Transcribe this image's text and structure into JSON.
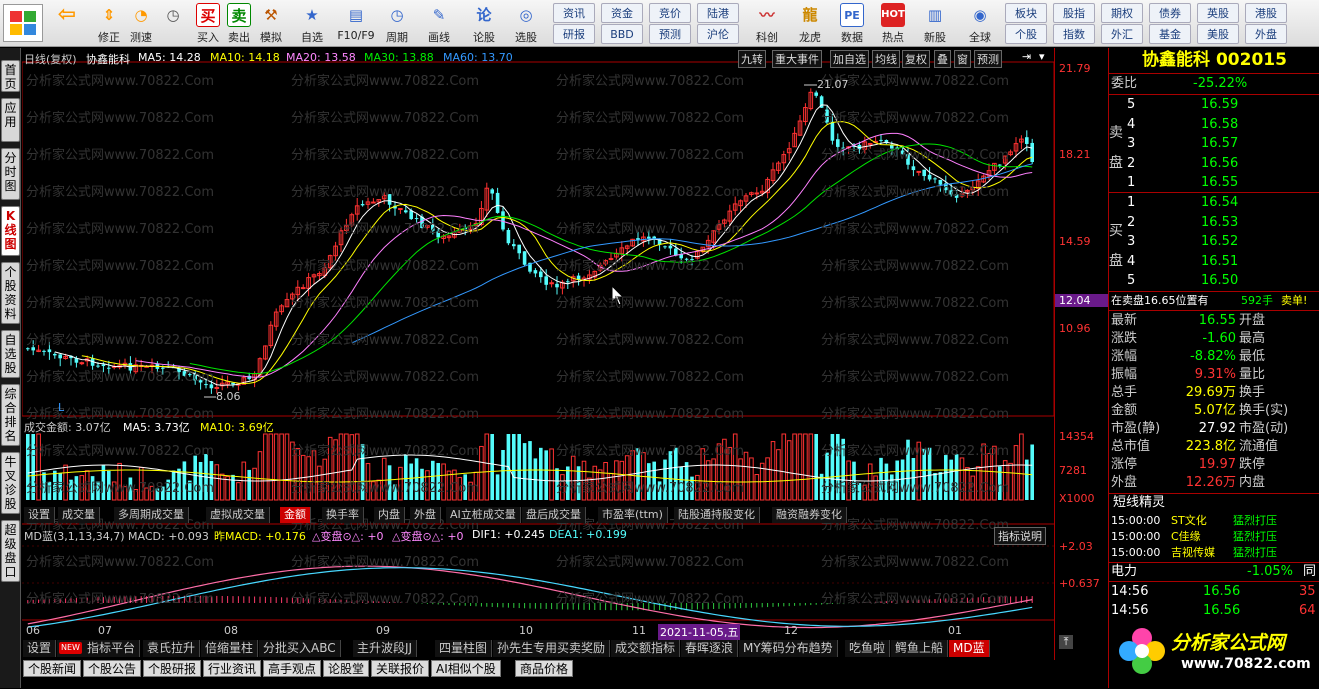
{
  "toolbar": {
    "buttons": [
      {
        "label": "",
        "icon": "logo-icon"
      },
      {
        "label": "",
        "icon": "back-arrow-icon"
      },
      {
        "label": "修正",
        "icon": "up-down-icon"
      },
      {
        "label": "测速",
        "icon": "stopwatch-icon"
      },
      {
        "label": "",
        "icon": "clock-icon"
      },
      {
        "label": "买入",
        "icon": "buy-icon"
      },
      {
        "label": "卖出",
        "icon": "sell-icon"
      },
      {
        "label": "模拟",
        "icon": "hammer-icon"
      },
      {
        "label": "自选",
        "icon": "star-icon"
      },
      {
        "label": "F10/F9",
        "icon": "f10-icon"
      },
      {
        "label": "周期",
        "icon": "period-icon"
      },
      {
        "label": "画线",
        "icon": "pencil-icon"
      },
      {
        "label": "论股",
        "icon": "forum-icon"
      },
      {
        "label": "选股",
        "icon": "select-icon"
      }
    ],
    "grid1": [
      "资讯",
      "资金",
      "竞价",
      "陆港",
      "研报",
      "BBD",
      "预测",
      "沪伦"
    ],
    "grid1_right": [
      {
        "label": "科创",
        "icon": "chart-icon"
      },
      {
        "label": "龙虎",
        "icon": "dragon-icon"
      },
      {
        "label": "数据",
        "icon": "pe-icon"
      },
      {
        "label": "热点",
        "icon": "hot-icon"
      },
      {
        "label": "新股",
        "icon": "doc-icon"
      },
      {
        "label": "全球",
        "icon": "globe-icon"
      }
    ],
    "grid2": [
      "板块",
      "股指",
      "期权",
      "债券",
      "英股",
      "港股",
      "个股",
      "指数",
      "外汇",
      "基金",
      "美股",
      "外盘"
    ]
  },
  "left_tabs": [
    {
      "label": "首页",
      "sel": false
    },
    {
      "label": "应用",
      "sel": false
    },
    {
      "label": "分时图",
      "sel": false
    },
    {
      "label": "K线图",
      "sel": true
    },
    {
      "label": "个股资料",
      "sel": false
    },
    {
      "label": "自选股",
      "sel": false
    },
    {
      "label": "综合排名",
      "sel": false
    },
    {
      "label": "牛叉诊股",
      "sel": false
    },
    {
      "label": "超级盘口",
      "sel": false
    }
  ],
  "header": {
    "period": "日线(复权)",
    "name": "协鑫能科",
    "ma5": "MA5: 14.28",
    "ma10": "MA10: 14.18",
    "ma20": "MA20: 13.58",
    "ma30": "MA30: 13.88",
    "ma60": "MA60: 13.70",
    "right_buttons": [
      "九转",
      "重大事件",
      "加自选",
      "均线",
      "复权",
      "叠",
      "窗",
      "预测"
    ]
  },
  "watermark": "分析家公式网www.70822.Com",
  "price_axis": [
    "21.79",
    "18.21",
    "14.59",
    "12.04",
    "10.96"
  ],
  "vol_axis": [
    "14354",
    "7281",
    "X1000"
  ],
  "macd_axis": [
    "+2.03",
    "+0.637"
  ],
  "annotations": {
    "high": "21.07",
    "low": "8.06",
    "marker": "L"
  },
  "vol_header": {
    "main": "成交金额: 3.07亿",
    "ma5": "MA5: 3.73亿",
    "ma10": "MA10: 3.69亿"
  },
  "vol_tabs": [
    "设置",
    "成交量",
    "多周期成交量",
    "虚拟成交量",
    "金额",
    "换手率",
    "内盘",
    "外盘",
    "AI立桩成交量",
    "盘后成交量",
    "市盈率(ttm)",
    "陆股通持股变化",
    "融资融券变化"
  ],
  "vol_tab_selected": 4,
  "macd_header": {
    "main": "MD蓝(3,1,13,34,7) MACD: +0.093",
    "prev": "昨MACD: +0.176",
    "a": "△变盘⊙△: +0",
    "b": "△变盘⊙△: +0",
    "dif": "DIF1: +0.245",
    "dea": "DEA1: +0.199"
  },
  "macd_button": "指标说明",
  "x_axis": [
    "06",
    "07",
    "08",
    "09",
    "10",
    "11",
    "2021-11-05,五",
    "12",
    "01"
  ],
  "bottom_tabs1": [
    "设置",
    "指标平台",
    "袁氏拉升",
    "倍缩量柱",
    "分批买入ABC",
    "主升波段JJ",
    "四量柱图",
    "孙先生专用买卖奖励",
    "成交额指标",
    "春晖逐浪",
    "MY筹码分布趋势",
    "吃鱼啦",
    "鳄鱼上船",
    "MD蓝"
  ],
  "bottom_tabs1_selected": 13,
  "bottom_tabs2": [
    "个股新闻",
    "个股公告",
    "个股研报",
    "行业资讯",
    "高手观点",
    "论股堂",
    "关联报价",
    "AI相似个股",
    "商品价格"
  ],
  "new_badge": "NEW",
  "quote": {
    "title": "协鑫能科 002015",
    "webi": {
      "label": "委比",
      "value": "-25.22%"
    },
    "sell_label": "卖盘",
    "buy_label": "买盘",
    "sell": [
      {
        "lvl": "5",
        "price": "16.59",
        "vol": ""
      },
      {
        "lvl": "4",
        "price": "16.58",
        "vol": ""
      },
      {
        "lvl": "3",
        "price": "16.57",
        "vol": ""
      },
      {
        "lvl": "2",
        "price": "16.56",
        "vol": ""
      },
      {
        "lvl": "1",
        "price": "16.55",
        "vol": ""
      }
    ],
    "buy": [
      {
        "lvl": "1",
        "price": "16.54",
        "vol": ""
      },
      {
        "lvl": "2",
        "price": "16.53",
        "vol": ""
      },
      {
        "lvl": "3",
        "price": "16.52",
        "vol": ""
      },
      {
        "lvl": "4",
        "price": "16.51",
        "vol": ""
      },
      {
        "lvl": "5",
        "price": "16.50",
        "vol": ""
      }
    ],
    "notice": {
      "text": "在卖盘16.65位置有",
      "amount": "592手",
      "tag": "卖单!"
    },
    "stats": [
      {
        "l": "最新",
        "v": "16.55",
        "r": "开盘",
        "c": "green"
      },
      {
        "l": "涨跌",
        "v": "-1.60",
        "r": "最高",
        "c": "green"
      },
      {
        "l": "涨幅",
        "v": "-8.82%",
        "r": "最低",
        "c": "green"
      },
      {
        "l": "振幅",
        "v": "9.31%",
        "r": "量比",
        "c": "red"
      },
      {
        "l": "总手",
        "v": "29.69万",
        "r": "换手",
        "c": "yellow"
      },
      {
        "l": "金额",
        "v": "5.07亿",
        "r": "换手(实)",
        "c": "yellow"
      },
      {
        "l": "市盈(静)",
        "v": "27.92",
        "r": "市盈(动)",
        "c": "white"
      },
      {
        "l": "总市值",
        "v": "223.8亿",
        "r": "流通值",
        "c": "yellow"
      },
      {
        "l": "涨停",
        "v": "19.97",
        "r": "跌停",
        "c": "red"
      },
      {
        "l": "外盘",
        "v": "12.26万",
        "r": "内盘",
        "c": "red"
      }
    ],
    "elf_title": "短线精灵",
    "elf": [
      {
        "time": "15:00:00",
        "name": "ST文化",
        "action": "猛烈打压"
      },
      {
        "time": "15:00:00",
        "name": "C佳缘",
        "action": "猛烈打压"
      },
      {
        "time": "15:00:00",
        "name": "吉视传媒",
        "action": "猛烈打压"
      }
    ],
    "sector": {
      "name": "电力",
      "pct": "-1.05%",
      "extra": "同"
    },
    "ticks": [
      {
        "time": "14:56",
        "price": "16.56",
        "vol": "35"
      },
      {
        "time": "14:56",
        "price": "16.56",
        "vol": "64"
      }
    ],
    "brand": "分析家公式网",
    "brand_url": "www.70822.com"
  },
  "colors": {
    "up": "#ff3232",
    "down": "#54fcfc",
    "ma5": "#ffffff",
    "ma10": "#ffff00",
    "ma20": "#ff80ff",
    "ma30": "#00e600",
    "ma60": "#3399ff"
  }
}
